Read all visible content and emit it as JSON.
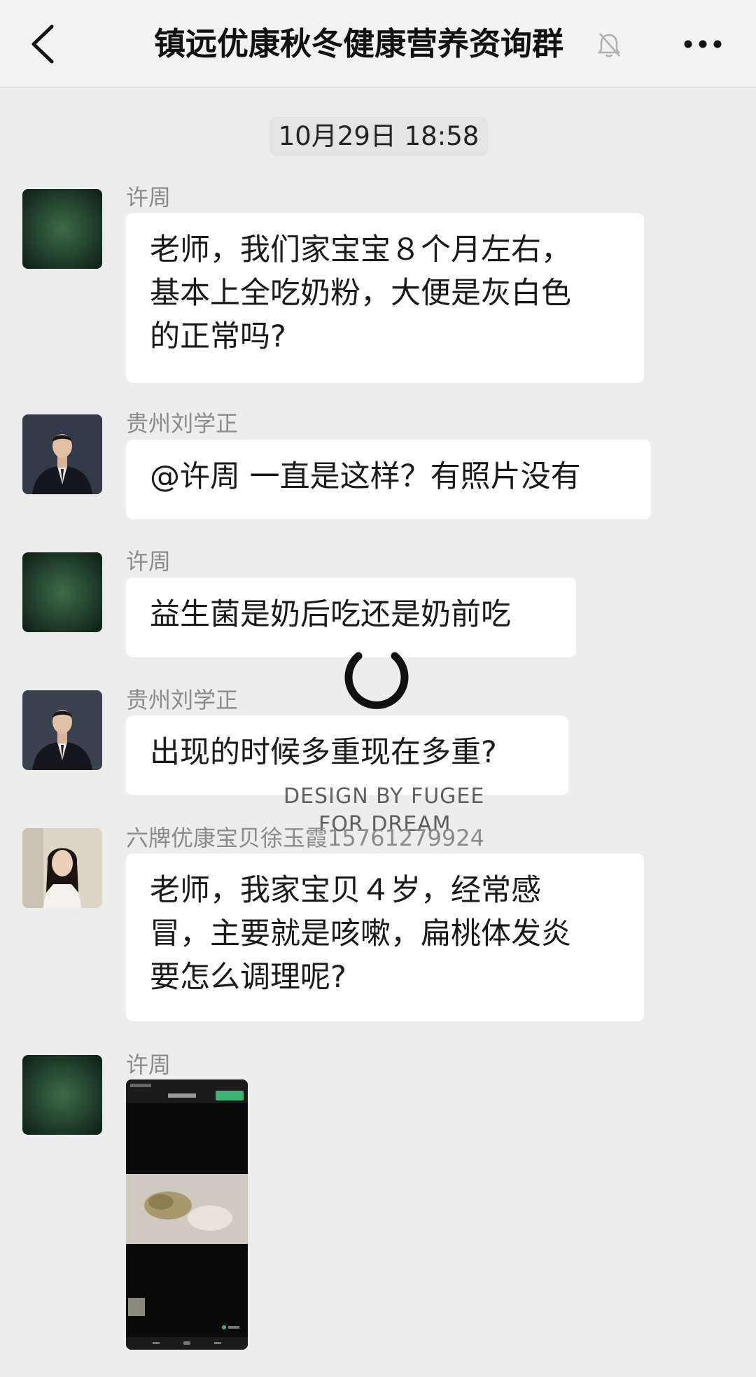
{
  "header": {
    "title": "镇远优康秋冬健康营养资询群",
    "back_icon": "chevron-left-icon",
    "mute_icon": "bell-off-icon",
    "more_icon": "more-horizontal-icon"
  },
  "timestamp": "10月29日 18:58",
  "messages": [
    {
      "sender": "许周",
      "lines": [
        "老师，我们家宝宝８个月左右，",
        "基本上全吃奶粉，大便是灰白色",
        "的正常吗?"
      ]
    },
    {
      "sender": "贵州刘学正",
      "lines": [
        "@许周 一直是这样？有照片没有"
      ]
    },
    {
      "sender": "许周",
      "lines": [
        "益生菌是奶后吃还是奶前吃"
      ]
    },
    {
      "sender": "贵州刘学正",
      "lines": [
        "出现的时候多重现在多重?"
      ]
    },
    {
      "sender": "六牌优康宝贝徐玉霞15761279924",
      "lines": [
        "老师，我家宝贝４岁，经常感",
        "冒，主要就是咳嗽，扁桃体发炎",
        "要怎么调理呢?"
      ]
    },
    {
      "sender": "许周",
      "image": "screenshot-image"
    }
  ],
  "watermark": {
    "line1": "DESIGN BY FUGEE",
    "line2": "FOR DREAM"
  },
  "colors": {
    "background": "#ededed",
    "bubble": "#ffffff",
    "header": "#f2f2f2",
    "sender": "#8b8b8b"
  }
}
